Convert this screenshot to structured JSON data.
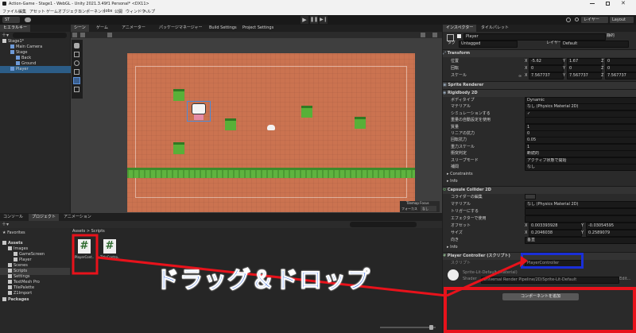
{
  "window": {
    "title": "Action-Game - Stage1 - WebGL - Unity 2021.3.49f1 Personal* <DX11>"
  },
  "menu": [
    "ファイル",
    "編集",
    "アセット",
    "ゲームオブジェクト",
    "コンポーネント",
    "Jobs",
    "公開",
    "ウィンドウ",
    "ヘルプ"
  ],
  "toolbar": {
    "account": "ST",
    "layers": "レイヤー",
    "layout": "Layout"
  },
  "hierarchy": {
    "tab": "ヒエラルキー",
    "items": [
      "Stage1*",
      "Main Camera",
      "Stage",
      "Back",
      "Ground",
      "Player"
    ]
  },
  "scene": {
    "tabs": [
      "シーン",
      "ゲーム",
      "アニメーター",
      "パッケージマネージャー",
      "Build Settings",
      "Project Settings"
    ],
    "overlay_title": "Tilemap Focus",
    "overlay_label": "フォーカス",
    "overlay_value": "なし"
  },
  "project": {
    "tabs": [
      "コンソール",
      "プロジェクト",
      "アニメーション"
    ],
    "favorites": "Favorites",
    "assets_root": "Assets",
    "tree": [
      "Images",
      "GameScreen",
      "Player",
      "Scenes",
      "Scripts",
      "Settings",
      "TextMesh Pro",
      "TilePalette",
      "Z1Import"
    ],
    "packages": "Packages",
    "breadcrumb": [
      "Assets",
      ">",
      "Scripts"
    ],
    "files": [
      "PlayerCont...",
      "TitleContro..."
    ]
  },
  "inspector": {
    "tabs": [
      "インスペクター",
      "タイルパレット"
    ],
    "object_name": "Player",
    "static_label": "静的",
    "tag_label": "タグ",
    "tag_value": "Untagged",
    "layer_label": "レイヤー",
    "layer_value": "Default",
    "transform": {
      "title": "Transform",
      "position_label": "位置",
      "rotation_label": "回転",
      "scale_label": "スケール",
      "position": [
        "-5.62",
        "1.67",
        "0"
      ],
      "rotation": [
        "0",
        "0",
        "0"
      ],
      "scale": [
        "7.567737",
        "7.567737",
        "7.567737"
      ],
      "axes": [
        "X",
        "Y",
        "Z"
      ]
    },
    "sprite_renderer": "Sprite Renderer",
    "rigidbody": {
      "title": "Rigidbody 2D",
      "rows": [
        {
          "label": "ボディタイプ",
          "value": "Dynamic"
        },
        {
          "label": "マテリアル",
          "value": "なし (Physics Material 2D)"
        },
        {
          "label": "シミュレーションする",
          "value": "✓"
        },
        {
          "label": "重量の自動設定を使用",
          "value": ""
        },
        {
          "label": "質量",
          "value": "1"
        },
        {
          "label": "リニアの抗力",
          "value": "0"
        },
        {
          "label": "回転抗力",
          "value": "0.05"
        },
        {
          "label": "重力スケール",
          "value": "1"
        },
        {
          "label": "衝突判定",
          "value": "断続的"
        },
        {
          "label": "スリープモード",
          "value": "アクティブ状態で開始"
        },
        {
          "label": "補間",
          "value": "なし"
        }
      ],
      "constraints": "Constraints",
      "info": "Info"
    },
    "capsule": {
      "title": "Capsule Collider 2D",
      "edit_label": "コライダーの編集",
      "rows": [
        {
          "label": "マテリアル",
          "value": "なし (Physics Material 2D)"
        },
        {
          "label": "トリガーにする",
          "value": ""
        },
        {
          "label": "エフェクターで使用",
          "value": ""
        }
      ],
      "offset_label": "オフセット",
      "offset": [
        "0.003393928",
        "-0.03054595"
      ],
      "size_label": "サイズ",
      "size": [
        "0.2046038",
        "0.2589079"
      ],
      "direction_label": "向き",
      "direction_value": "垂直",
      "info": "Info"
    },
    "player_controller": {
      "title": "Player Controller (スクリプト)",
      "script_label": "スクリプト",
      "script_value": "PlayerController"
    },
    "material": {
      "name": "Sprite-Lit-Default (Material)",
      "shader_label": "Shader",
      "shader_value": "Universal Render Pipeline/2D/Sprite-Lit-Default",
      "edit": "Edit..."
    },
    "add_component": "コンポーネントを追加"
  },
  "annotation": {
    "text": "ドラッグ＆ドロップ",
    "color": "#e8121b",
    "text_color": "#1a57e0",
    "highlight_color": "#1a2fd8"
  }
}
